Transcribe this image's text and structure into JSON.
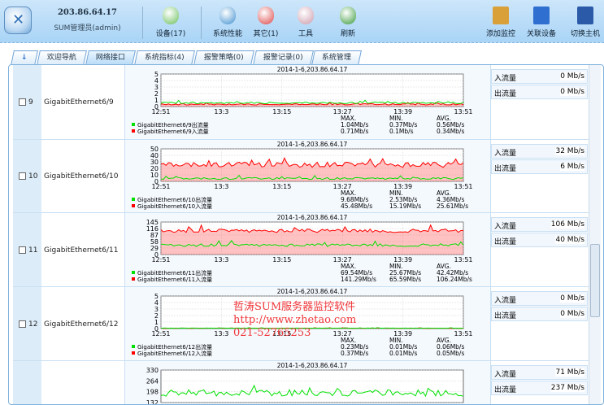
{
  "header": {
    "ip": "203.86.64.17",
    "user": "SUM管理员(admin)"
  },
  "toolbar": [
    {
      "label": "设备(17)",
      "icon": "device-icon",
      "color": "#6bbf5a"
    },
    {
      "label": "系统性能",
      "icon": "performance-icon",
      "color": "#3f8fcf"
    },
    {
      "label": "其它(1)",
      "icon": "other-icon",
      "color": "#d44"
    },
    {
      "label": "工具",
      "icon": "tools-icon",
      "color": "#c9a"
    },
    {
      "label": "刷新",
      "icon": "refresh-icon",
      "color": "#3a9a3a"
    }
  ],
  "toolbar_right": [
    {
      "label": "添加监控",
      "icon": "add-monitor-icon",
      "color": "#d9a03a"
    },
    {
      "label": "关联设备",
      "icon": "link-device-icon",
      "color": "#2f6fcf"
    },
    {
      "label": "切换主机",
      "icon": "switch-host-icon",
      "color": "#2a5aa8"
    }
  ],
  "tabs": [
    {
      "label": "欢迎导航"
    },
    {
      "label": "网络接口",
      "active": true
    },
    {
      "label": "系统指标(4)"
    },
    {
      "label": "报警策略(0)"
    },
    {
      "label": "报警记录(0)"
    },
    {
      "label": "系统管理"
    }
  ],
  "labels": {
    "in": "入流量",
    "out": "出流量",
    "max": "MAX.",
    "min": "MIN.",
    "avg": "AVG."
  },
  "watermark": [
    "哲涛SUM服务器监控软件",
    "http://www.zhetao.com",
    "021-52765253"
  ],
  "colors": {
    "in": "#ff0000",
    "out": "#00e000"
  },
  "chart_data": [
    {
      "type": "line",
      "num": "9",
      "name": "GigabitEthernet6/9",
      "title": "2014-1-6,203.86.64.17",
      "yticks": [
        "5",
        "4",
        "3",
        "2",
        "1",
        "0"
      ],
      "ymax": 5,
      "xticks": [
        "12:51",
        "13:3",
        "13:15",
        "13:27",
        "13:39",
        "13:51"
      ],
      "legend_out": "GigabitEthernet6/9出流量",
      "legend_in": "GigabitEthernet6/9入流量",
      "out_stats": [
        "1.04Mb/s",
        "0.37Mb/s",
        "0.56Mb/s"
      ],
      "in_stats": [
        "0.71Mb/s",
        "0.1Mb/s",
        "0.34Mb/s"
      ],
      "out_level": 0.56,
      "out_amp": 0.25,
      "in_level": 0.34,
      "in_amp": 0.2,
      "in_now": "0 Mb/s",
      "out_now": "0 Mb/s"
    },
    {
      "type": "line",
      "num": "10",
      "name": "GigabitEthernet6/10",
      "title": "2014-1-6,203.86.64.17",
      "yticks": [
        "50",
        "40",
        "30",
        "20",
        "10",
        "0"
      ],
      "ymax": 50,
      "xticks": [
        "12:51",
        "13:3",
        "13:15",
        "13:27",
        "13:39",
        "13:51"
      ],
      "legend_out": "GigabitEthernet6/10出流量",
      "legend_in": "GigabitEthernet6/10入流量",
      "out_stats": [
        "9.68Mb/s",
        "2.53Mb/s",
        "4.36Mb/s"
      ],
      "in_stats": [
        "45.48Mb/s",
        "15.19Mb/s",
        "25.61Mb/s"
      ],
      "out_level": 4.36,
      "out_amp": 3,
      "in_level": 25.6,
      "in_amp": 8,
      "in_now": "32 Mb/s",
      "out_now": "6 Mb/s"
    },
    {
      "type": "line",
      "num": "11",
      "name": "GigabitEthernet6/11",
      "title": "2014-1-6,203.86.64.17",
      "yticks": [
        "145",
        "116",
        "87",
        "58",
        "29",
        "0"
      ],
      "ymax": 145,
      "xticks": [
        "12:51",
        "13:3",
        "13:15",
        "13:27",
        "13:39",
        "13:51"
      ],
      "legend_out": "GigabitEthernet6/11出流量",
      "legend_in": "GigabitEthernet6/11入流量",
      "out_stats": [
        "69.54Mb/s",
        "25.67Mb/s",
        "42.42Mb/s"
      ],
      "in_stats": [
        "141.29Mb/s",
        "65.59Mb/s",
        "106.24Mb/s"
      ],
      "out_level": 42,
      "out_amp": 12,
      "in_level": 106,
      "in_amp": 15,
      "in_now": "106 Mb/s",
      "out_now": "40 Mb/s"
    },
    {
      "type": "line",
      "num": "12",
      "name": "GigabitEthernet6/12",
      "title": "2014-1-6,203.86.64.17",
      "yticks": [
        "5",
        "4",
        "3",
        "2",
        "1",
        "0"
      ],
      "ymax": 5,
      "xticks": [
        "12:51",
        "13:3",
        "13:15",
        "13:27",
        "13:39",
        "13:51"
      ],
      "legend_out": "GigabitEthernet6/12出流量",
      "legend_in": "GigabitEthernet6/12入流量",
      "out_stats": [
        "0.23Mb/s",
        "0.01Mb/s",
        "0.06Mb/s"
      ],
      "in_stats": [
        "0.37Mb/s",
        "0.01Mb/s",
        "0.05Mb/s"
      ],
      "out_level": 0.06,
      "out_amp": 0.05,
      "in_level": 0.05,
      "in_amp": 0.05,
      "in_now": "0 Mb/s",
      "out_now": "0 Mb/s"
    },
    {
      "type": "line",
      "num": "",
      "name": "",
      "title": "2014-1-6,203.86.64.17",
      "yticks": [
        "330",
        "264",
        "198",
        "132"
      ],
      "ymax": 330,
      "ymin": 132,
      "xticks": [],
      "out_level": 190,
      "out_amp": 40,
      "in_level": null,
      "in_now": "71 Mb/s",
      "out_now": "237 Mb/s"
    }
  ]
}
